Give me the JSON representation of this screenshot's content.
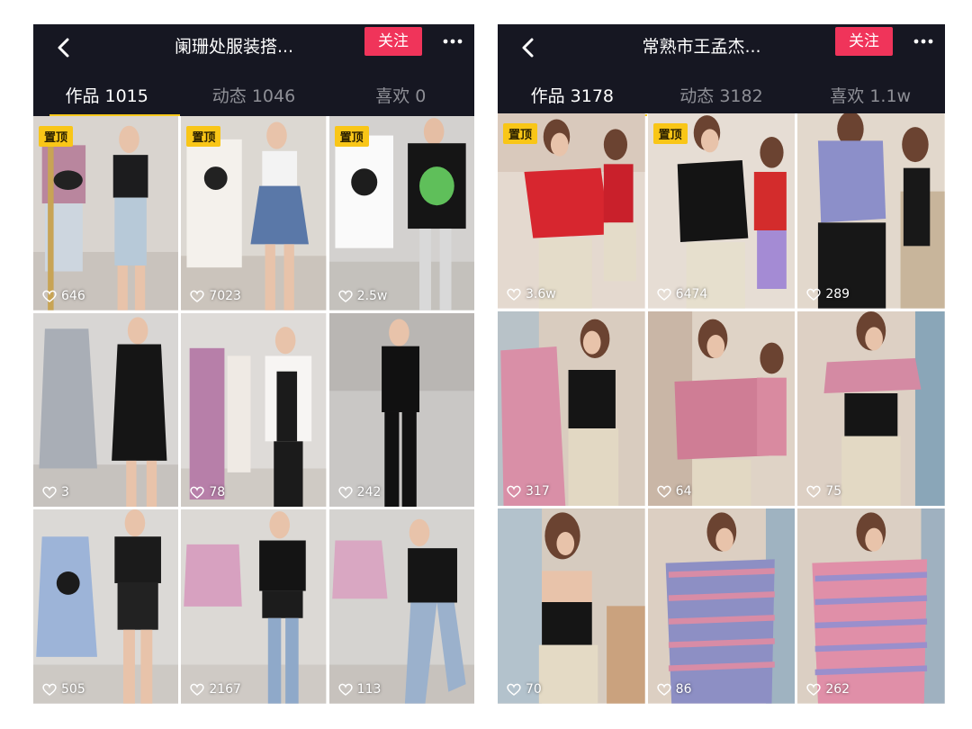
{
  "left": {
    "title": "阑珊处服装搭...",
    "follow": "关注",
    "tabs": [
      "作品 1015",
      "动态 1046",
      "喜欢 0"
    ],
    "pin_label": "置顶",
    "videos": [
      {
        "likes": "646",
        "pinned": true
      },
      {
        "likes": "7023",
        "pinned": true
      },
      {
        "likes": "2.5w",
        "pinned": true
      },
      {
        "likes": "3",
        "pinned": false
      },
      {
        "likes": "78",
        "pinned": false
      },
      {
        "likes": "242",
        "pinned": false
      },
      {
        "likes": "505",
        "pinned": false
      },
      {
        "likes": "2167",
        "pinned": false
      },
      {
        "likes": "113",
        "pinned": false
      }
    ]
  },
  "right": {
    "title": "常熟市王孟杰...",
    "follow": "关注",
    "tabs": [
      "作品 3178",
      "动态 3182",
      "喜欢 1.1w"
    ],
    "pin_label": "置顶",
    "videos": [
      {
        "likes": "3.6w",
        "pinned": true
      },
      {
        "likes": "6474",
        "pinned": true
      },
      {
        "likes": "289",
        "pinned": false
      },
      {
        "likes": "317",
        "pinned": false
      },
      {
        "likes": "64",
        "pinned": false
      },
      {
        "likes": "75",
        "pinned": false
      },
      {
        "likes": "70",
        "pinned": false
      },
      {
        "likes": "86",
        "pinned": false
      },
      {
        "likes": "262",
        "pinned": false
      }
    ]
  },
  "colors": {
    "background": "#161722",
    "follow": "#f0345a",
    "pin": "#f9c617",
    "tab_underline": "#f8c81b"
  }
}
